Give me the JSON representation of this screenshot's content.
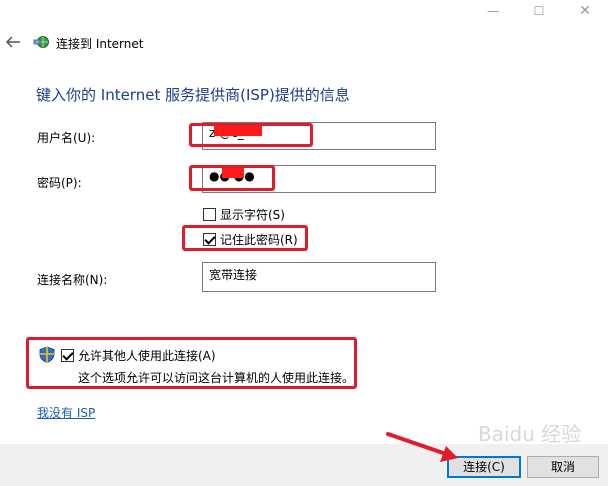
{
  "window": {
    "minimize_glyph": "—",
    "maximize_glyph": "☐",
    "close_glyph": "✕"
  },
  "wizard": {
    "title": "连接到 Internet"
  },
  "heading": "键入你的 Internet 服务提供商(ISP)提供的信息",
  "form": {
    "username_label": "用户名(U):",
    "username_value": "z          @c_",
    "password_label": "密码(P):",
    "password_value": "●●    ●●",
    "show_chars_label": "显示字符(S)",
    "remember_label": "记住此密码(R)",
    "connection_name_label": "连接名称(N):",
    "connection_name_value": "宽带连接"
  },
  "allow_others": {
    "label": "允许其他人使用此连接(A)",
    "description": "这个选项允许可以访问这台计算机的人使用此连接。"
  },
  "no_isp_link": "我没有 ISP",
  "buttons": {
    "connect": "连接(C)",
    "cancel": "取消"
  },
  "watermark": "Baidu 经验",
  "colors": {
    "annotation_red": "#e01b2a",
    "heading_blue": "#1e3d8f",
    "link_blue": "#1a5fb4",
    "focus_blue": "#0078d7"
  }
}
